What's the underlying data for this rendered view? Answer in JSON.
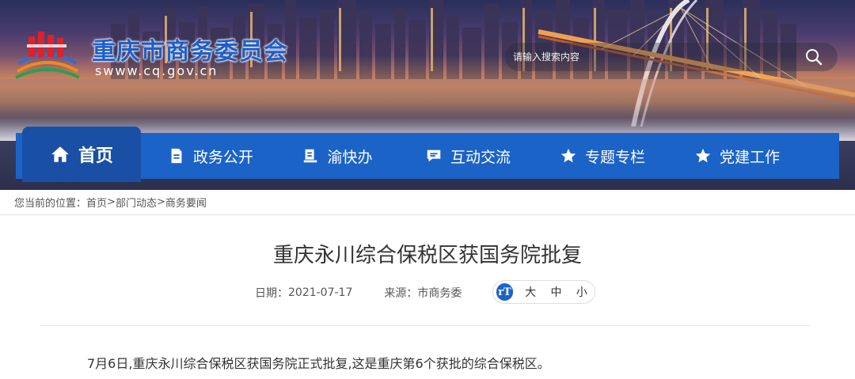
{
  "header": {
    "site_title": "重庆市商务委员会",
    "site_domain": "swww.cq.gov.cn",
    "search_placeholder": "请输入搜索内容"
  },
  "nav": {
    "items": [
      {
        "label": "首页",
        "icon": "home-icon",
        "active": true
      },
      {
        "label": "政务公开",
        "icon": "document-icon"
      },
      {
        "label": "渝快办",
        "icon": "office-icon"
      },
      {
        "label": "互动交流",
        "icon": "chat-icon"
      },
      {
        "label": "专题专栏",
        "icon": "star-icon"
      },
      {
        "label": "党建工作",
        "icon": "star-icon"
      }
    ]
  },
  "breadcrumb": {
    "prefix": "您当前的位置：",
    "items": [
      "首页",
      "部门动态",
      "商务要闻"
    ],
    "separator": ">"
  },
  "article": {
    "title": "重庆永川综合保税区获国务院批复",
    "date_label": "日期：",
    "date": "2021-07-17",
    "source_label": "来源：",
    "source": "市商务委",
    "font_size_icon": "font-size-icon",
    "font_sizes": [
      "大",
      "中",
      "小"
    ],
    "body": "7月6日,重庆永川综合保税区获国务院正式批复,这是重庆第6个获批的综合保税区。"
  },
  "colors": {
    "brand_blue": "#1c63c8",
    "nav_active": "#1a4fa6"
  }
}
